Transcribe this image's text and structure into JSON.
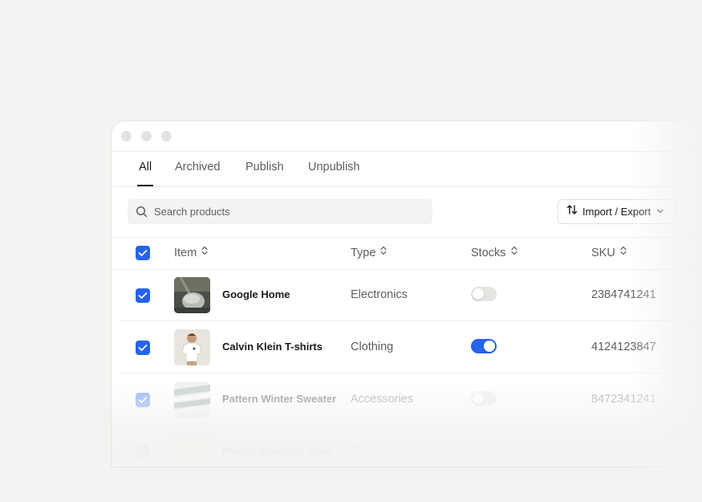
{
  "window": {
    "controls": [
      "close",
      "minimize",
      "maximize"
    ]
  },
  "tabs": [
    {
      "label": "All",
      "active": true
    },
    {
      "label": "Archived",
      "active": false
    },
    {
      "label": "Publish",
      "active": false
    },
    {
      "label": "Unpublish",
      "active": false
    }
  ],
  "search": {
    "placeholder": "Search products",
    "value": "",
    "icon": "search-icon"
  },
  "import_export": {
    "label": "Import / Export",
    "icon": "sort-arrows-icon",
    "caret": "chevron-down-icon"
  },
  "table": {
    "headers": {
      "item": "Item",
      "type": "Type",
      "stocks": "Stocks",
      "sku": "SKU"
    },
    "select_all_checked": true,
    "rows": [
      {
        "name": "Google Home",
        "type": "Electronics",
        "in_stock": false,
        "sku": "2384741241",
        "checked": true,
        "thumb": "google-home-thumbnail"
      },
      {
        "name": "Calvin Klein T-shirts",
        "type": "Clothing",
        "in_stock": true,
        "sku": "4124123847",
        "checked": true,
        "thumb": "tshirt-thumbnail"
      },
      {
        "name": "Pattern Winter Sweater",
        "type": "Accessories",
        "in_stock": false,
        "sku": "8472341241",
        "checked": true,
        "thumb": "sweater-thumbnail"
      },
      {
        "name": "Mango Women's shoe",
        "type": "Shoes",
        "in_stock": false,
        "sku": "2412384741",
        "checked": true,
        "thumb": "shoe-thumbnail"
      }
    ]
  },
  "colors": {
    "accent": "#2563eb",
    "background": "#f4f3f1",
    "toggle_off": "#e5e4e1"
  }
}
